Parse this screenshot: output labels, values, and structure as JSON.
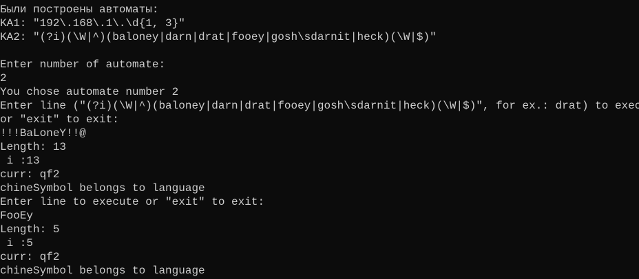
{
  "console": {
    "lines": [
      "Были построены автоматы:",
      "KA1: \"192\\.168\\.1\\.\\d{1, 3}\"",
      "KA2: \"(?i)(\\W|^)(baloney|darn|drat|fooey|gosh\\sdarnit|heck)(\\W|$)\"",
      "",
      "Enter number of automate:",
      "2",
      "You chose automate number 2",
      "Enter line (\"(?i)(\\W|^)(baloney|darn|drat|fooey|gosh\\sdarnit|heck)(\\W|$)\", for ex.: drat) to execute",
      "or \"exit\" to exit:",
      "!!!BaLoneY!!@",
      "Length: 13",
      " i :13",
      "curr: qf2",
      "chineSymbol belongs to language",
      "Enter line to execute or \"exit\" to exit:",
      "FooEy",
      "Length: 5",
      " i :5",
      "curr: qf2",
      "chineSymbol belongs to language"
    ]
  }
}
